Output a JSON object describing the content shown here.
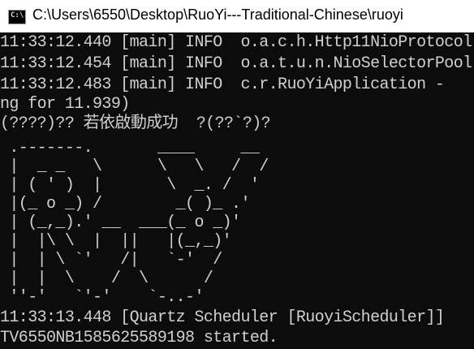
{
  "window": {
    "title": "C:\\Users\\6550\\Desktop\\RuoYi---Traditional-Chinese\\ruoyi",
    "icon": "cmd-console-icon",
    "icon_text": "C:\\."
  },
  "console": {
    "lines": [
      "11:33:12.440 [main] INFO  o.a.c.h.Http11NioProtocol",
      "11:33:12.454 [main] INFO  o.a.t.u.n.NioSelectorPool",
      "11:33:12.483 [main] INFO  c.r.RuoYiApplication - ",
      "ng for 11.939)",
      "(????)?? 若依啟動成功  ?(??`?)?",
      " .-------.       ____     __",
      " |  _ _   \\      \\   \\   /  /",
      " | ( ' )  |       \\  _. /  '",
      " |(_ o _) /        _( )_ .'",
      " | (_,_).' __  ___(_ o _)'",
      " |  |\\ \\  |  ||   |(_,_)'",
      " |  | \\ `'   /|   `-'  /",
      " |  |  \\    /  \\      /",
      " ''-'   `'-'    `-..-'",
      "11:33:13.448 [Quartz Scheduler [RuoyiScheduler]]",
      "TV6550NB1585625589198 started."
    ]
  }
}
